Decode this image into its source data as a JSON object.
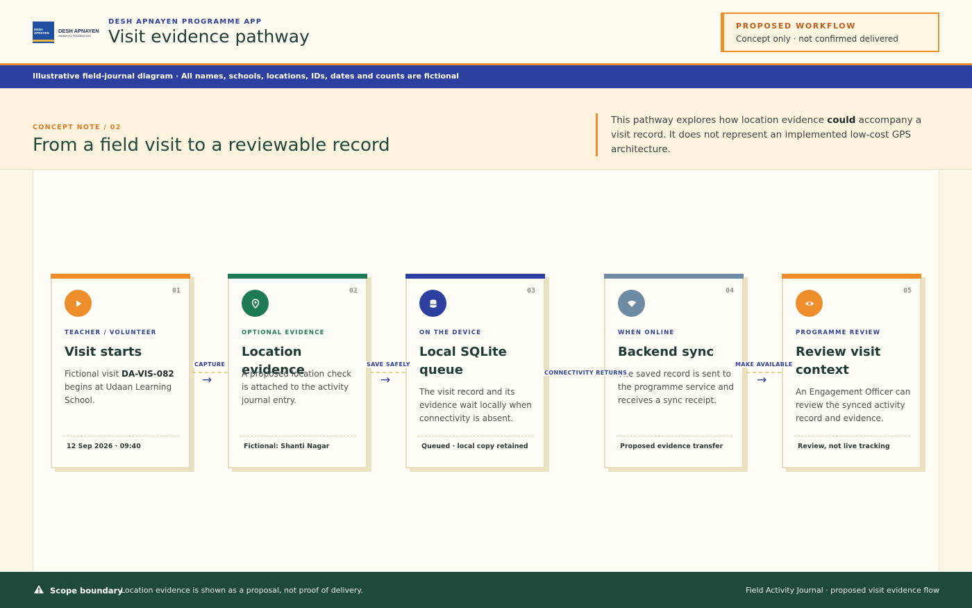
{
  "brand": {
    "logo_mark_text": "DESH APNAYEN",
    "logo_name": "DESH APNAYEN",
    "logo_sub": "SAHAYOG FOUNDATION"
  },
  "header": {
    "kicker": "DESH APNAYEN PROGRAMME APP",
    "title": "Visit evidence pathway",
    "badge_title": "PROPOSED WORKFLOW",
    "badge_sub": "Concept only · not confirmed delivered"
  },
  "banner": "Illustrative field-journal diagram · All names, schools, locations, IDs, dates and counts are fictional",
  "concept": {
    "kicker": "CONCEPT NOTE / 02",
    "title": "From a field visit to a reviewable record",
    "note_pre": "This pathway explores how location evidence ",
    "note_bold": "could",
    "note_post": " accompany a visit record. It does not represent an implemented low-cost GPS architecture."
  },
  "cards": [
    {
      "num": "01",
      "kicker": "TEACHER / VOLUNTEER",
      "title": "Visit starts",
      "body_pre": "Fictional visit ",
      "body_bold": "DA-VIS-082",
      "body_post": " begins at Udaan Learning School.",
      "foot": "12 Sep 2026 · 09:40",
      "icon": "play-icon",
      "color": "#ee8d2c"
    },
    {
      "num": "02",
      "kicker": "OPTIONAL EVIDENCE",
      "title": "Location evidence",
      "body": "A proposed location check is attached to the activity journal entry.",
      "foot": "Fictional: Shanti Nagar",
      "icon": "map-pin-icon",
      "color": "#1e7a55"
    },
    {
      "num": "03",
      "kicker": "ON THE DEVICE",
      "title": "Local SQLite queue",
      "body": "The visit record and its evidence wait locally when connectivity is absent.",
      "foot": "Queued · local copy retained",
      "icon": "database-icon",
      "color": "#2d40a0"
    },
    {
      "num": "04",
      "kicker": "WHEN ONLINE",
      "title": "Backend sync",
      "body": "The saved record is sent to the programme service and receives a sync receipt.",
      "foot": "Proposed evidence transfer",
      "icon": "wifi-icon",
      "color": "#6f8ba3"
    },
    {
      "num": "05",
      "kicker": "PROGRAMME REVIEW",
      "title": "Review visit context",
      "body": "An Engagement Officer can review the synced activity record and evidence.",
      "foot": "Review, not live tracking",
      "icon": "eye-icon",
      "color": "#ee8d2c"
    }
  ],
  "connectors": [
    "CAPTURE",
    "SAVE SAFELY",
    "CONNECTIVITY RETURNS",
    "MAKE AVAILABLE"
  ],
  "footer": {
    "label": "Scope boundary",
    "text": "Location evidence is shown as a proposal, not proof of delivery.",
    "right": "Field Activity Journal · proposed visit evidence flow"
  }
}
